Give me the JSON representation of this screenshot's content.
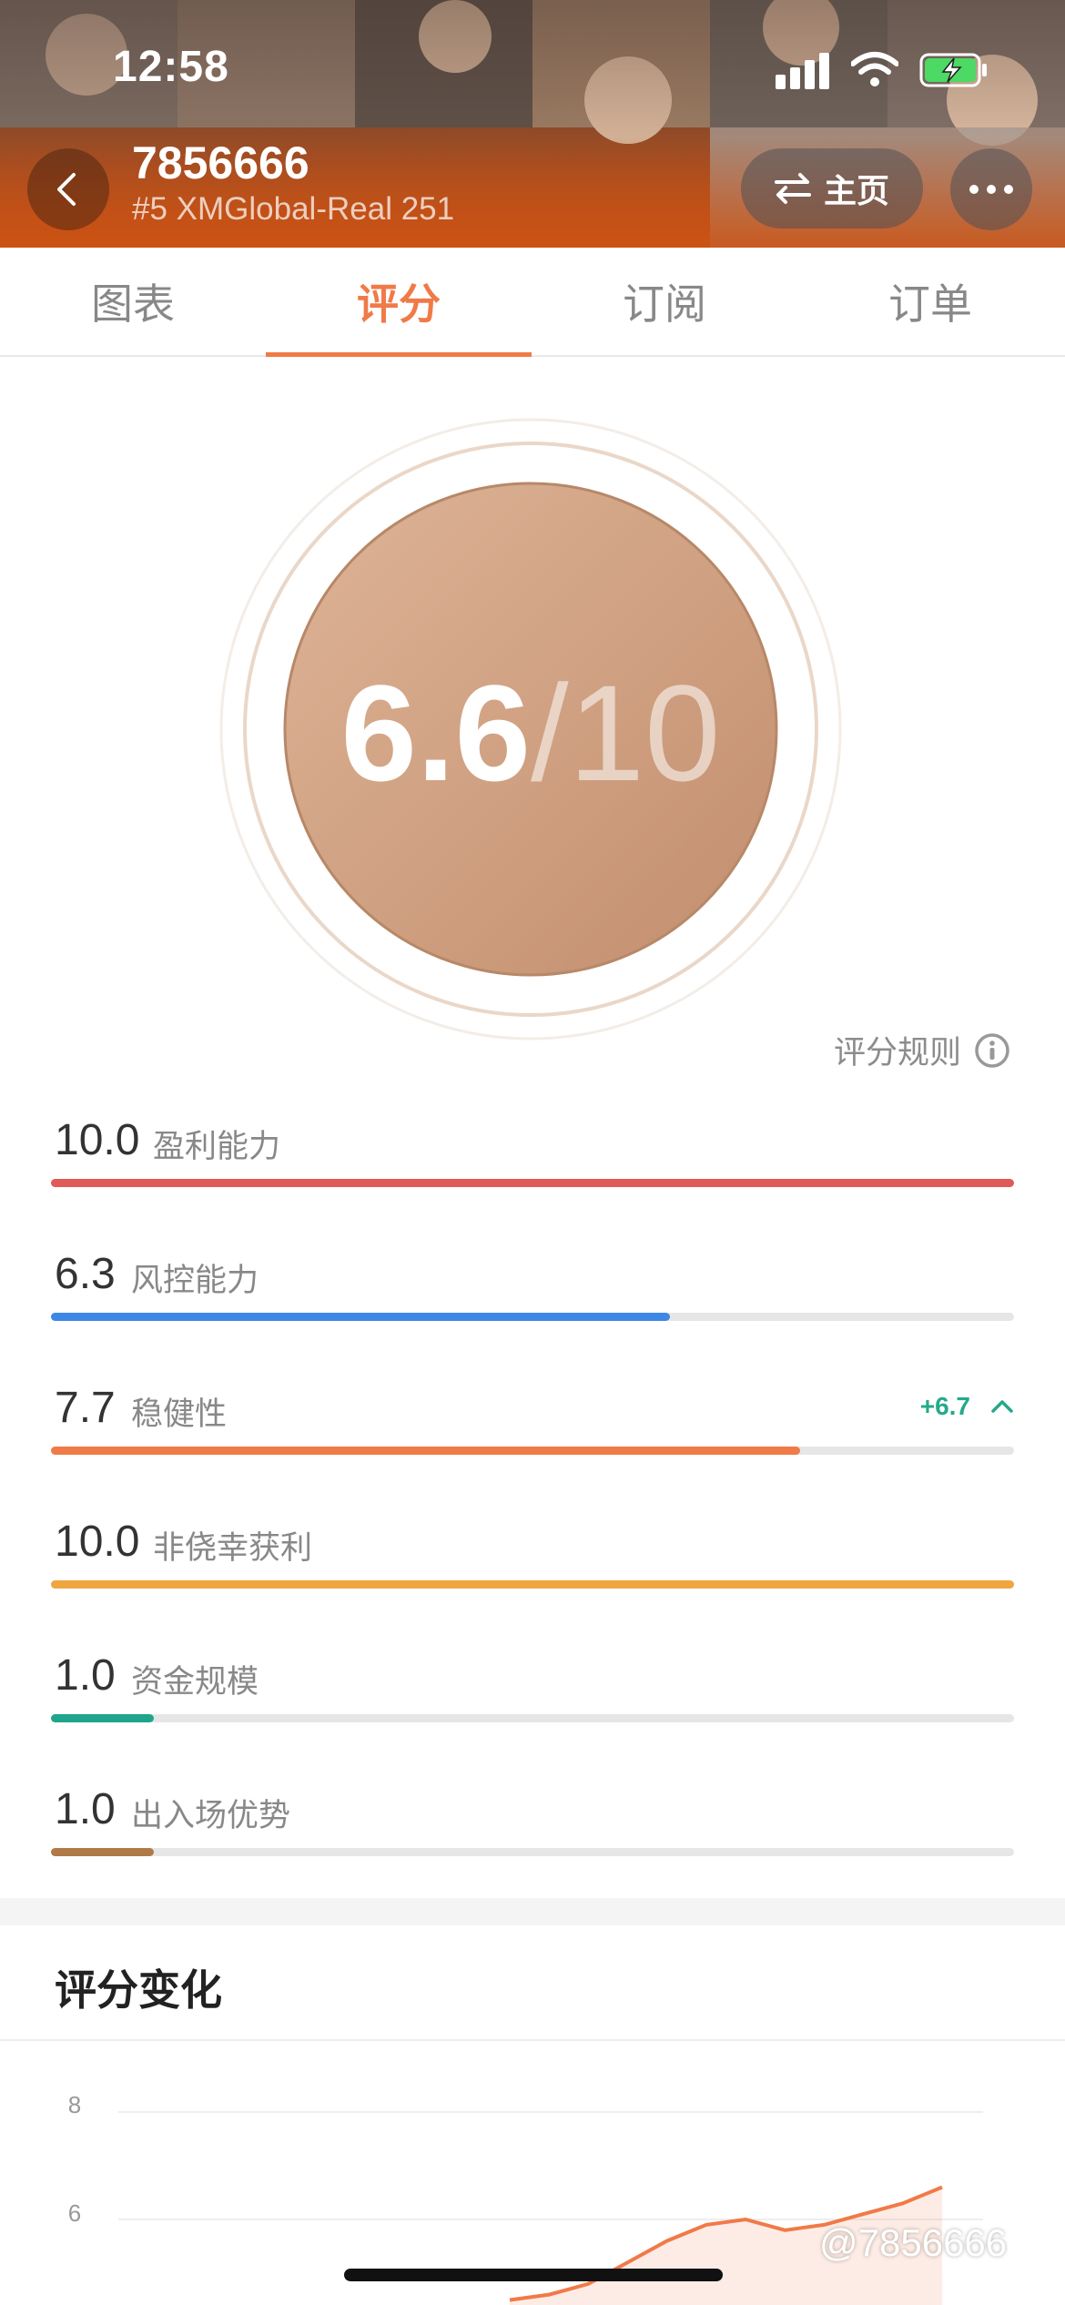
{
  "status_bar": {
    "time": "12:58"
  },
  "header": {
    "account_id": "7856666",
    "account_sub": "#5 XMGlobal-Real 251",
    "home_button_label": "主页"
  },
  "tabs": [
    {
      "label": "图表",
      "active": false
    },
    {
      "label": "评分",
      "active": true
    },
    {
      "label": "订阅",
      "active": false
    },
    {
      "label": "订单",
      "active": false
    }
  ],
  "score": {
    "value": "6.6",
    "max": "/10"
  },
  "rules_link": "评分规则",
  "metrics": [
    {
      "value": "10.0",
      "label": "盈利能力",
      "fraction": 1.0,
      "color": "#e05a57"
    },
    {
      "value": "6.3",
      "label": "风控能力",
      "fraction": 0.643,
      "color": "#3d87e6"
    },
    {
      "value": "7.7",
      "label": "稳健性",
      "fraction": 0.778,
      "color": "#f07a48",
      "change": "+6.7"
    },
    {
      "value": "10.0",
      "label": "非侥幸获利",
      "fraction": 1.0,
      "color": "#f0a640"
    },
    {
      "value": "1.0",
      "label": "资金规模",
      "fraction": 0.107,
      "color": "#1fa58c"
    },
    {
      "value": "1.0",
      "label": "出入场优势",
      "fraction": 0.107,
      "color": "#b07a48"
    }
  ],
  "change_section": {
    "title": "评分变化"
  },
  "chart_data": {
    "type": "area",
    "y_ticks": [
      "8",
      "6"
    ],
    "ylim": [
      5,
      8.5
    ],
    "series": [
      {
        "values": [
          4.5,
          4.6,
          4.8,
          5.2,
          5.6,
          5.9,
          6.0,
          5.8,
          5.9,
          6.1,
          6.3,
          6.6
        ]
      }
    ],
    "color": "#f07a48"
  },
  "watermark": "@7856666"
}
